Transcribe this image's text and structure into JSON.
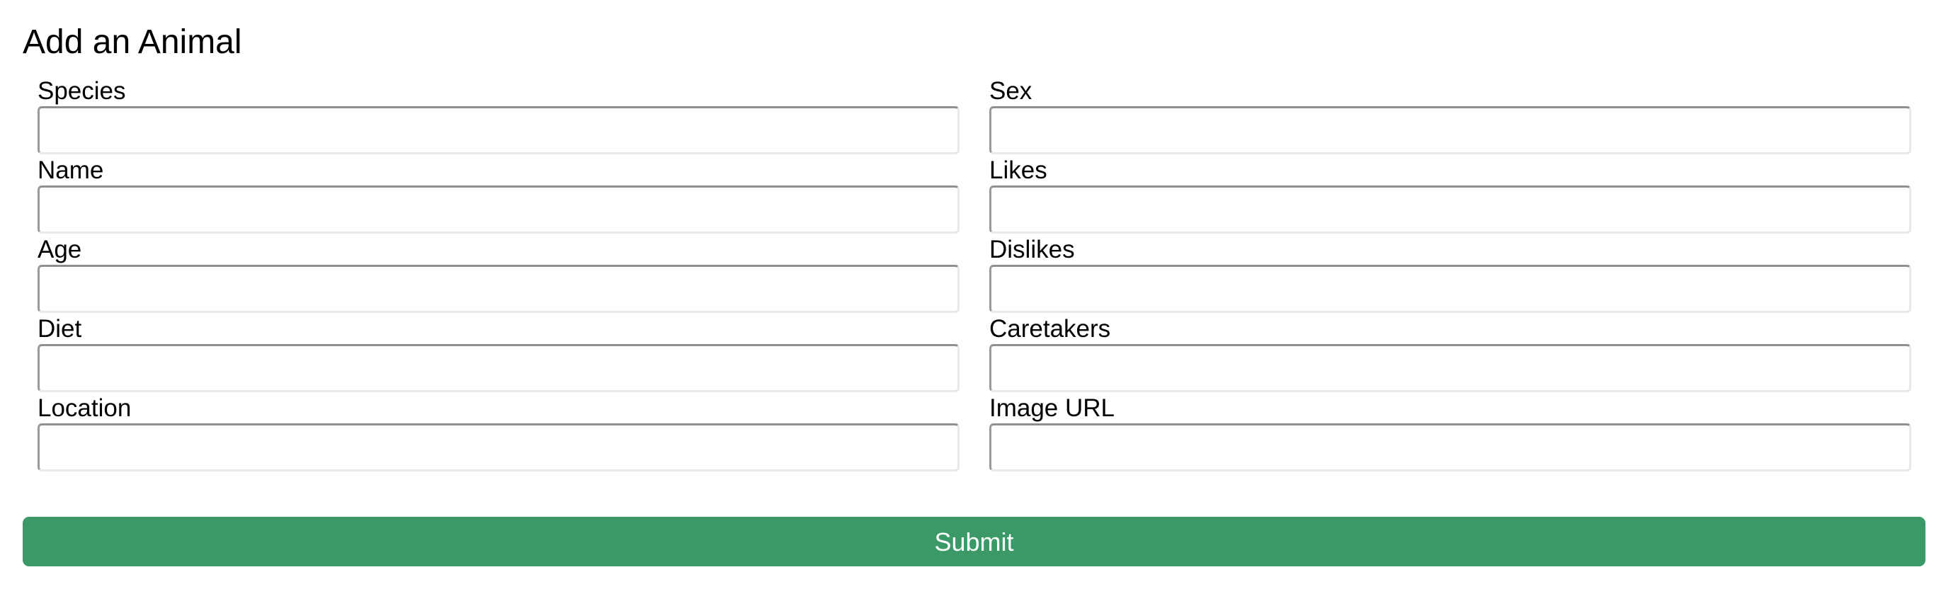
{
  "page": {
    "title": "Add an Animal"
  },
  "form": {
    "fields": {
      "species": {
        "label": "Species",
        "value": "",
        "placeholder": ""
      },
      "name": {
        "label": "Name",
        "value": "",
        "placeholder": ""
      },
      "age": {
        "label": "Age",
        "value": "",
        "placeholder": ""
      },
      "diet": {
        "label": "Diet",
        "value": "",
        "placeholder": ""
      },
      "location": {
        "label": "Location",
        "value": "",
        "placeholder": ""
      },
      "sex": {
        "label": "Sex",
        "value": "",
        "placeholder": ""
      },
      "likes": {
        "label": "Likes",
        "value": "",
        "placeholder": ""
      },
      "dislikes": {
        "label": "Dislikes",
        "value": "",
        "placeholder": ""
      },
      "caretakers": {
        "label": "Caretakers",
        "value": "",
        "placeholder": ""
      },
      "image_url": {
        "label": "Image URL",
        "value": "",
        "placeholder": ""
      }
    },
    "submit_label": "Submit"
  },
  "colors": {
    "submit_background": "#3a9966",
    "submit_text": "#ffffff",
    "input_border_dark": "#8f8f8f",
    "input_border_light": "#e8e8e8",
    "text": "#000000",
    "background": "#ffffff"
  }
}
